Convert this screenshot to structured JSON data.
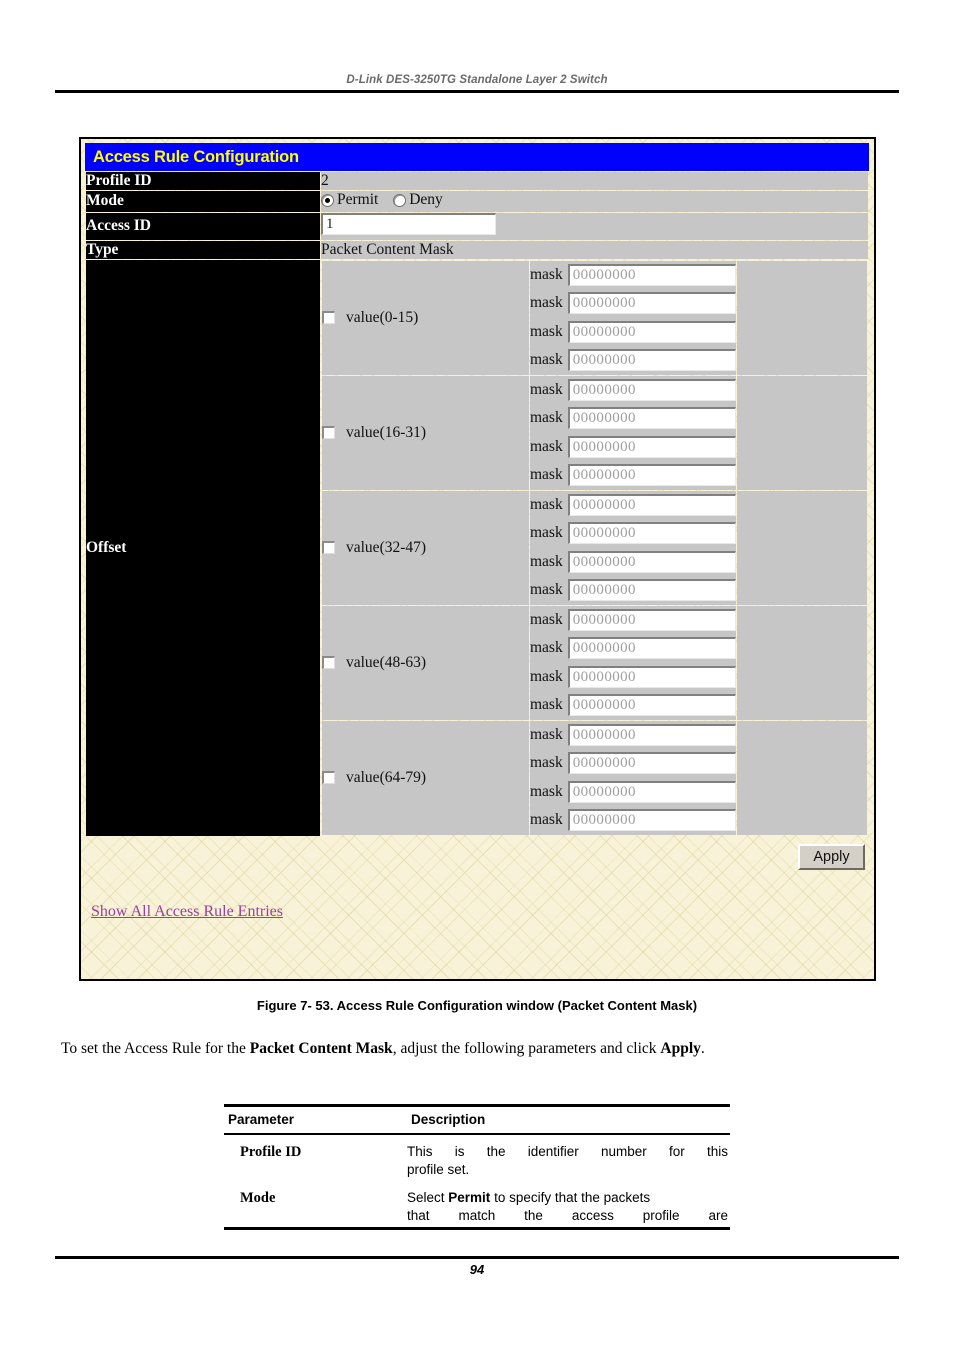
{
  "page": {
    "running_header": "D-Link DES-3250TG Standalone Layer 2 Switch",
    "page_number": "94",
    "figure_caption": "Figure 7- 53. Access Rule Configuration window (Packet Content Mask)",
    "intro_prefix": "To set the Access Rule for the ",
    "intro_bold1": "Packet Content Mask",
    "intro_middle": ", adjust the following parameters and click ",
    "intro_bold2": "Apply",
    "intro_suffix": "."
  },
  "window": {
    "title": "Access Rule Configuration",
    "colors": {
      "titlebar_bg": "#0000ff",
      "title_fg": "#ffff00",
      "label_bg": "#000000",
      "label_fg": "#ffffff",
      "field_bg": "#c6c6c6",
      "frame_bg": "#f7f2d8",
      "link_fg": "#9a3fa0"
    },
    "rows": [
      {
        "label": "Profile ID",
        "value": "2"
      },
      {
        "label": "Mode",
        "value": ""
      },
      {
        "label": "Access ID",
        "value": "1"
      },
      {
        "label": "Type",
        "value": "Packet Content Mask"
      }
    ],
    "mode": {
      "options": [
        {
          "label": "Permit",
          "selected": true
        },
        {
          "label": "Deny",
          "selected": false
        }
      ]
    },
    "access_id": {
      "value": "1"
    },
    "offset": {
      "label": "Offset",
      "mask_label": "mask",
      "mask_value": "00000000",
      "groups": [
        {
          "checkbox_label": "value(0-15)",
          "checked": false,
          "masks": [
            "00000000",
            "00000000",
            "00000000",
            "00000000"
          ]
        },
        {
          "checkbox_label": "value(16-31)",
          "checked": false,
          "masks": [
            "00000000",
            "00000000",
            "00000000",
            "00000000"
          ]
        },
        {
          "checkbox_label": "value(32-47)",
          "checked": false,
          "masks": [
            "00000000",
            "00000000",
            "00000000",
            "00000000"
          ]
        },
        {
          "checkbox_label": "value(48-63)",
          "checked": false,
          "masks": [
            "00000000",
            "00000000",
            "00000000",
            "00000000"
          ]
        },
        {
          "checkbox_label": "value(64-79)",
          "checked": false,
          "masks": [
            "00000000",
            "00000000",
            "00000000",
            "00000000"
          ]
        }
      ]
    },
    "apply_label": "Apply",
    "show_all_link": "Show All Access Rule Entries"
  },
  "param_table": {
    "headers": {
      "parameter": "Parameter",
      "description": "Description"
    },
    "rows": [
      {
        "name": "Profile ID",
        "desc_line1": "This is the identifier number for this",
        "desc_line2": "profile set."
      },
      {
        "name": "Mode",
        "desc_pre": "Select ",
        "desc_bold": "Permit",
        "desc_post": " to specify that the packets",
        "desc_line2": "that match the access profile are"
      }
    ]
  }
}
